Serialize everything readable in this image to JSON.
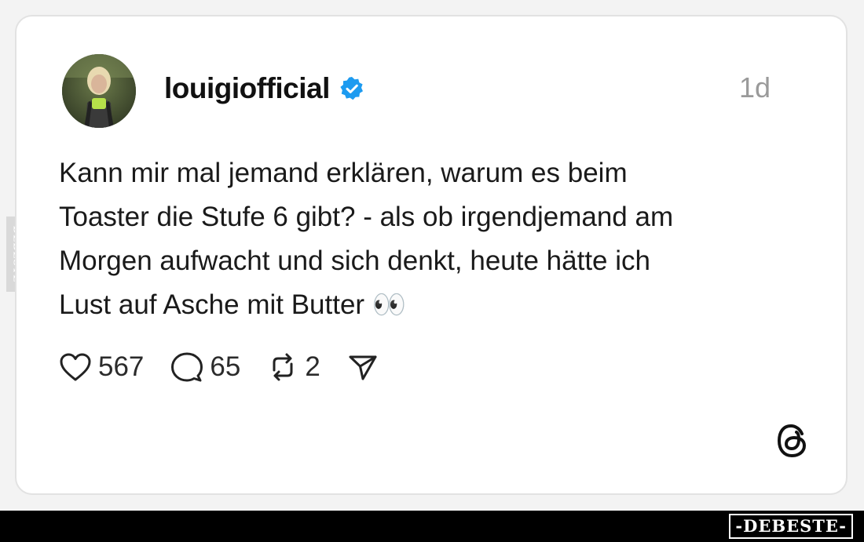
{
  "post": {
    "username": "louigiofficial",
    "verified": true,
    "timestamp": "1d",
    "text": "Kann mir mal jemand erklären, warum es beim\nToaster die Stufe 6 gibt? - als ob irgendjemand am\nMorgen aufwacht und sich denkt, heute hätte ich\nLust auf Asche mit Butter 👀"
  },
  "actions": {
    "likes": "567",
    "comments": "65",
    "reposts": "2"
  },
  "icons": {
    "like": "heart-icon",
    "comment": "comment-bubble-icon",
    "repost": "repost-icon",
    "share": "send-icon",
    "verified": "verified-badge-icon",
    "brand": "threads-logo-icon"
  },
  "colors": {
    "verified": "#1d9bf0",
    "text": "#1a1a1a",
    "muted": "#9a9a9a",
    "footer": "#000000"
  },
  "watermark": {
    "side": "DEBESTE",
    "footer": "-DEBESTE-"
  }
}
